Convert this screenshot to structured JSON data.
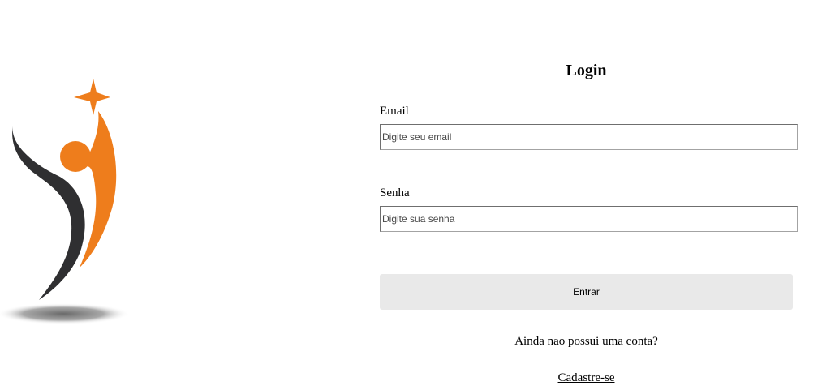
{
  "login": {
    "title": "Login",
    "email_label": "Email",
    "email_placeholder": "Digite seu email",
    "email_value": "",
    "password_label": "Senha",
    "password_placeholder": "Digite sua senha",
    "password_value": "",
    "submit_label": "Entrar",
    "signup_prompt": "Ainda nao possui uma conta?",
    "signup_link": "Cadastre-se"
  },
  "logo": {
    "icon": "person-star-logo",
    "colors": {
      "orange": "#ee7d1c",
      "dark": "#2f2f31",
      "shadow": "#8a8a8a"
    }
  },
  "colors": {
    "button_bg": "#e9e9e9",
    "field_border": "#a3a3a3"
  }
}
